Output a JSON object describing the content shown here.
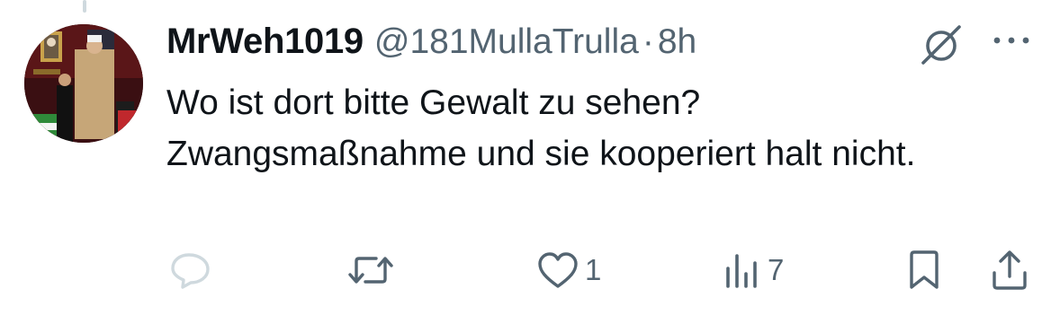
{
  "tweet": {
    "display_name": "MrWeh1019",
    "handle": "@181MullaTrulla",
    "separator": "·",
    "time": "8h",
    "text": "Wo ist dort bitte Gewalt zu sehen?\nZwangsmaßnahme und sie kooperiert halt nicht."
  },
  "actions": {
    "reply": {
      "icon": "reply-icon",
      "count": ""
    },
    "retweet": {
      "icon": "retweet-icon",
      "count": ""
    },
    "like": {
      "icon": "heart-icon",
      "count": "1"
    },
    "views": {
      "icon": "views-icon",
      "count": "7"
    },
    "bookmark": {
      "icon": "bookmark-icon"
    },
    "share": {
      "icon": "share-icon"
    }
  },
  "header_icons": {
    "grok": "grok-icon",
    "more": "more-icon"
  },
  "colors": {
    "text": "#0f1419",
    "secondary": "#536471",
    "reply_disabled": "#cfd9de"
  }
}
